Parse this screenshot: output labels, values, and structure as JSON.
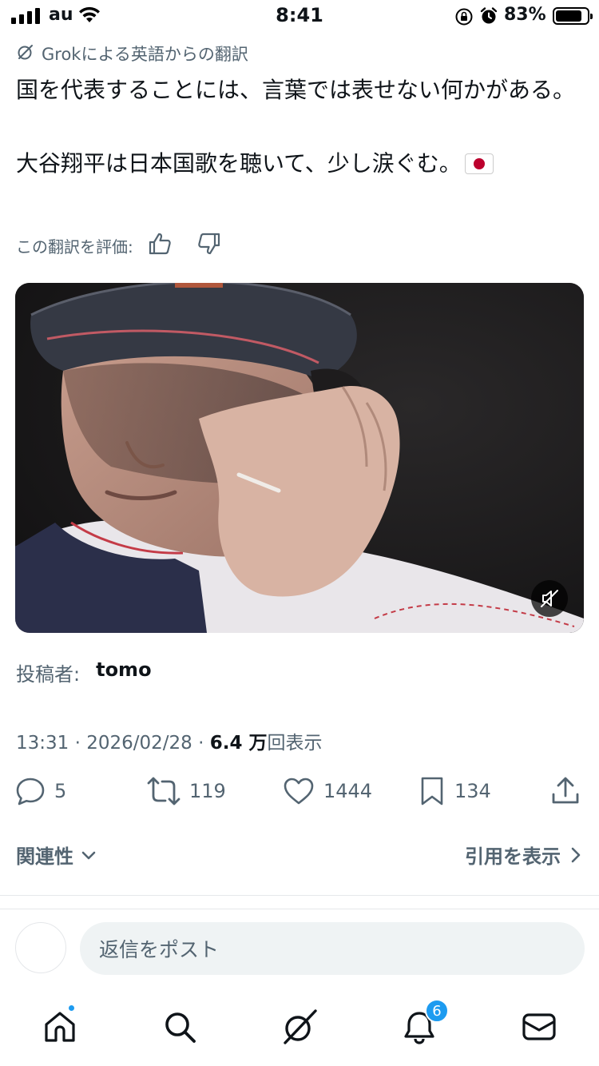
{
  "status_bar": {
    "carrier": "au",
    "time": "8:41",
    "battery_percent": "83%",
    "battery_level": 0.83,
    "icons": [
      "signal-icon",
      "wifi-icon",
      "orientation-lock-icon",
      "alarm-icon",
      "battery-icon"
    ]
  },
  "translation": {
    "note": "Grokによる英語からの翻訳",
    "lines": [
      "国を代表することには、言葉では表せない何かがある。",
      "大谷翔平は日本国歌を聴いて、少し涙ぐむ。"
    ],
    "flag_emoji": "🇯🇵",
    "rate_label": "この翻訳を評価:"
  },
  "media": {
    "type": "video",
    "muted": true
  },
  "poster": {
    "label": "投稿者:",
    "name": "tomo"
  },
  "meta": {
    "time": "13:31",
    "sep1": " · ",
    "date": "2026/02/28",
    "sep2": " · ",
    "views_count": "6.4 万",
    "views_label": "回表示"
  },
  "actions": {
    "replies": "5",
    "reposts": "119",
    "likes": "1444",
    "bookmarks": "134"
  },
  "links": {
    "relevance": "関連性",
    "quotes": "引用を表示"
  },
  "reply": {
    "placeholder": "返信をポスト"
  },
  "tabbar": {
    "notifications_badge": "6"
  },
  "colors": {
    "accent": "#1d9bf0",
    "text": "#0f1419",
    "secondary": "#536471",
    "input_bg": "#eff3f4"
  }
}
